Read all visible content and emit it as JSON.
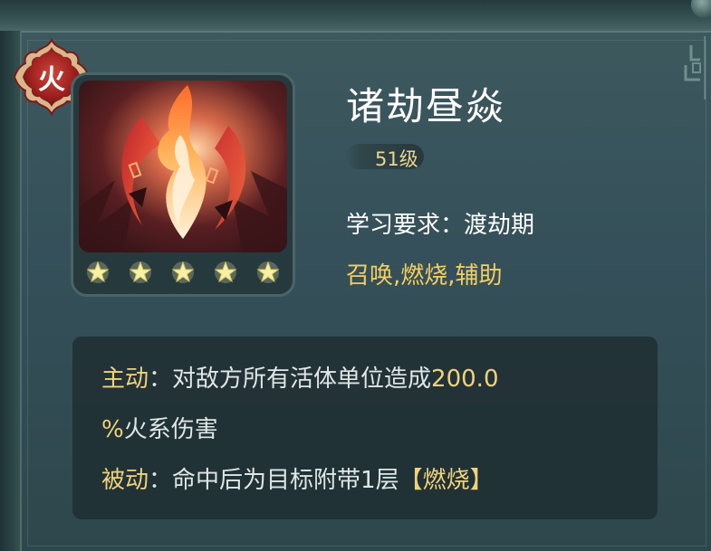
{
  "element": {
    "label": "火",
    "icon": "fire-element-badge-icon"
  },
  "skill": {
    "name": "诸劫昼焱",
    "level": "51级",
    "requirement": "学习要求：渡劫期",
    "tags": "召唤,燃烧,辅助",
    "stars": 5,
    "icon": "flame-skill-icon"
  },
  "description": {
    "active_label": "主动",
    "active_sep": "：",
    "active_text_1": "对敌方所有活体单位造成",
    "active_value_1": "200.0",
    "active_value_2": "%",
    "active_text_2": "火系伤害",
    "passive_label": "被动",
    "passive_sep": "：",
    "passive_text": "命中后为目标附带1层",
    "passive_effect": "【燃烧】"
  },
  "colors": {
    "gold": "#f0d27a",
    "tag_gold": "#f2cf5e",
    "badge_red": "#b32a2a",
    "panel": "#35505a"
  }
}
